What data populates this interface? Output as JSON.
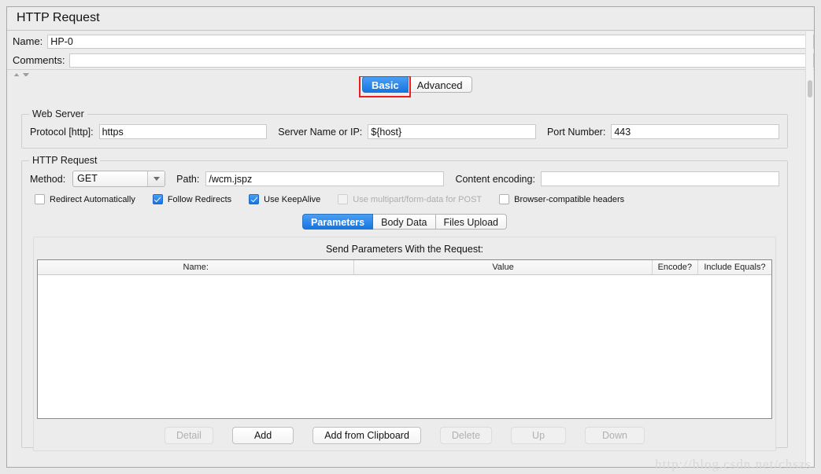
{
  "window": {
    "title": "HTTP Request"
  },
  "header": {
    "name_label": "Name:",
    "name_value": "HP-0",
    "comments_label": "Comments:",
    "comments_value": ""
  },
  "top_tabs": {
    "items": [
      {
        "label": "Basic",
        "active": true,
        "highlighted": true
      },
      {
        "label": "Advanced",
        "active": false,
        "highlighted": false
      }
    ],
    "highlight_color": "#ee1c1c"
  },
  "web_server": {
    "title": "Web Server",
    "protocol_label": "Protocol [http]:",
    "protocol_value": "https",
    "server_label": "Server Name or IP:",
    "server_value": "${host}",
    "port_label": "Port Number:",
    "port_value": "443"
  },
  "http_request": {
    "title": "HTTP Request",
    "method_label": "Method:",
    "method_value": "GET",
    "path_label": "Path:",
    "path_value": "/wcm.jspz",
    "encoding_label": "Content encoding:",
    "encoding_value": "",
    "checkboxes": [
      {
        "label": "Redirect Automatically",
        "checked": false,
        "disabled": false
      },
      {
        "label": "Follow Redirects",
        "checked": true,
        "disabled": false
      },
      {
        "label": "Use KeepAlive",
        "checked": true,
        "disabled": false
      },
      {
        "label": "Use multipart/form-data for POST",
        "checked": false,
        "disabled": true
      },
      {
        "label": "Browser-compatible headers",
        "checked": false,
        "disabled": false
      }
    ]
  },
  "inner_tabs": {
    "items": [
      {
        "label": "Parameters",
        "active": true
      },
      {
        "label": "Body Data",
        "active": false
      },
      {
        "label": "Files Upload",
        "active": false
      }
    ]
  },
  "parameters_panel": {
    "send_params_label": "Send Parameters With the Request:",
    "table": {
      "columns": [
        "Name:",
        "Value",
        "Encode?",
        "Include Equals?"
      ],
      "rows": []
    },
    "buttons": [
      {
        "label": "Detail",
        "disabled": true
      },
      {
        "label": "Add",
        "disabled": false
      },
      {
        "label": "Add from Clipboard",
        "disabled": false
      },
      {
        "label": "Delete",
        "disabled": true
      },
      {
        "label": "Up",
        "disabled": true
      },
      {
        "label": "Down",
        "disabled": true
      }
    ]
  },
  "watermark": {
    "text": "http://blog.csdn.net/chszs"
  }
}
